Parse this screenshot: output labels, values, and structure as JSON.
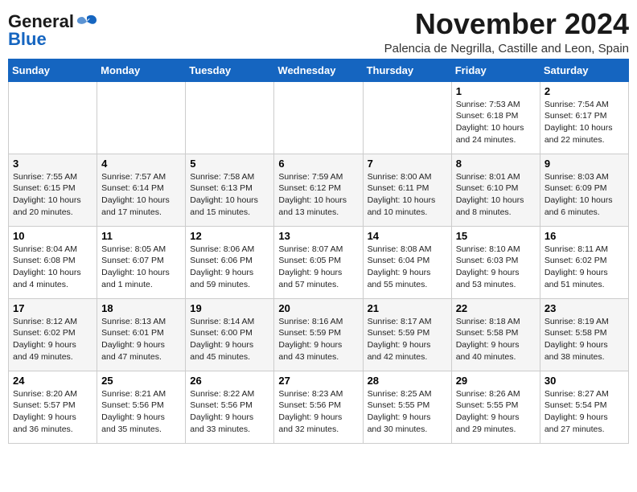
{
  "logo": {
    "line1": "General",
    "line2": "Blue"
  },
  "title": "November 2024",
  "subtitle": "Palencia de Negrilla, Castille and Leon, Spain",
  "headers": [
    "Sunday",
    "Monday",
    "Tuesday",
    "Wednesday",
    "Thursday",
    "Friday",
    "Saturday"
  ],
  "weeks": [
    [
      {
        "day": "",
        "info": ""
      },
      {
        "day": "",
        "info": ""
      },
      {
        "day": "",
        "info": ""
      },
      {
        "day": "",
        "info": ""
      },
      {
        "day": "",
        "info": ""
      },
      {
        "day": "1",
        "info": "Sunrise: 7:53 AM\nSunset: 6:18 PM\nDaylight: 10 hours and 24 minutes."
      },
      {
        "day": "2",
        "info": "Sunrise: 7:54 AM\nSunset: 6:17 PM\nDaylight: 10 hours and 22 minutes."
      }
    ],
    [
      {
        "day": "3",
        "info": "Sunrise: 7:55 AM\nSunset: 6:15 PM\nDaylight: 10 hours and 20 minutes."
      },
      {
        "day": "4",
        "info": "Sunrise: 7:57 AM\nSunset: 6:14 PM\nDaylight: 10 hours and 17 minutes."
      },
      {
        "day": "5",
        "info": "Sunrise: 7:58 AM\nSunset: 6:13 PM\nDaylight: 10 hours and 15 minutes."
      },
      {
        "day": "6",
        "info": "Sunrise: 7:59 AM\nSunset: 6:12 PM\nDaylight: 10 hours and 13 minutes."
      },
      {
        "day": "7",
        "info": "Sunrise: 8:00 AM\nSunset: 6:11 PM\nDaylight: 10 hours and 10 minutes."
      },
      {
        "day": "8",
        "info": "Sunrise: 8:01 AM\nSunset: 6:10 PM\nDaylight: 10 hours and 8 minutes."
      },
      {
        "day": "9",
        "info": "Sunrise: 8:03 AM\nSunset: 6:09 PM\nDaylight: 10 hours and 6 minutes."
      }
    ],
    [
      {
        "day": "10",
        "info": "Sunrise: 8:04 AM\nSunset: 6:08 PM\nDaylight: 10 hours and 4 minutes."
      },
      {
        "day": "11",
        "info": "Sunrise: 8:05 AM\nSunset: 6:07 PM\nDaylight: 10 hours and 1 minute."
      },
      {
        "day": "12",
        "info": "Sunrise: 8:06 AM\nSunset: 6:06 PM\nDaylight: 9 hours and 59 minutes."
      },
      {
        "day": "13",
        "info": "Sunrise: 8:07 AM\nSunset: 6:05 PM\nDaylight: 9 hours and 57 minutes."
      },
      {
        "day": "14",
        "info": "Sunrise: 8:08 AM\nSunset: 6:04 PM\nDaylight: 9 hours and 55 minutes."
      },
      {
        "day": "15",
        "info": "Sunrise: 8:10 AM\nSunset: 6:03 PM\nDaylight: 9 hours and 53 minutes."
      },
      {
        "day": "16",
        "info": "Sunrise: 8:11 AM\nSunset: 6:02 PM\nDaylight: 9 hours and 51 minutes."
      }
    ],
    [
      {
        "day": "17",
        "info": "Sunrise: 8:12 AM\nSunset: 6:02 PM\nDaylight: 9 hours and 49 minutes."
      },
      {
        "day": "18",
        "info": "Sunrise: 8:13 AM\nSunset: 6:01 PM\nDaylight: 9 hours and 47 minutes."
      },
      {
        "day": "19",
        "info": "Sunrise: 8:14 AM\nSunset: 6:00 PM\nDaylight: 9 hours and 45 minutes."
      },
      {
        "day": "20",
        "info": "Sunrise: 8:16 AM\nSunset: 5:59 PM\nDaylight: 9 hours and 43 minutes."
      },
      {
        "day": "21",
        "info": "Sunrise: 8:17 AM\nSunset: 5:59 PM\nDaylight: 9 hours and 42 minutes."
      },
      {
        "day": "22",
        "info": "Sunrise: 8:18 AM\nSunset: 5:58 PM\nDaylight: 9 hours and 40 minutes."
      },
      {
        "day": "23",
        "info": "Sunrise: 8:19 AM\nSunset: 5:58 PM\nDaylight: 9 hours and 38 minutes."
      }
    ],
    [
      {
        "day": "24",
        "info": "Sunrise: 8:20 AM\nSunset: 5:57 PM\nDaylight: 9 hours and 36 minutes."
      },
      {
        "day": "25",
        "info": "Sunrise: 8:21 AM\nSunset: 5:56 PM\nDaylight: 9 hours and 35 minutes."
      },
      {
        "day": "26",
        "info": "Sunrise: 8:22 AM\nSunset: 5:56 PM\nDaylight: 9 hours and 33 minutes."
      },
      {
        "day": "27",
        "info": "Sunrise: 8:23 AM\nSunset: 5:56 PM\nDaylight: 9 hours and 32 minutes."
      },
      {
        "day": "28",
        "info": "Sunrise: 8:25 AM\nSunset: 5:55 PM\nDaylight: 9 hours and 30 minutes."
      },
      {
        "day": "29",
        "info": "Sunrise: 8:26 AM\nSunset: 5:55 PM\nDaylight: 9 hours and 29 minutes."
      },
      {
        "day": "30",
        "info": "Sunrise: 8:27 AM\nSunset: 5:54 PM\nDaylight: 9 hours and 27 minutes."
      }
    ]
  ]
}
